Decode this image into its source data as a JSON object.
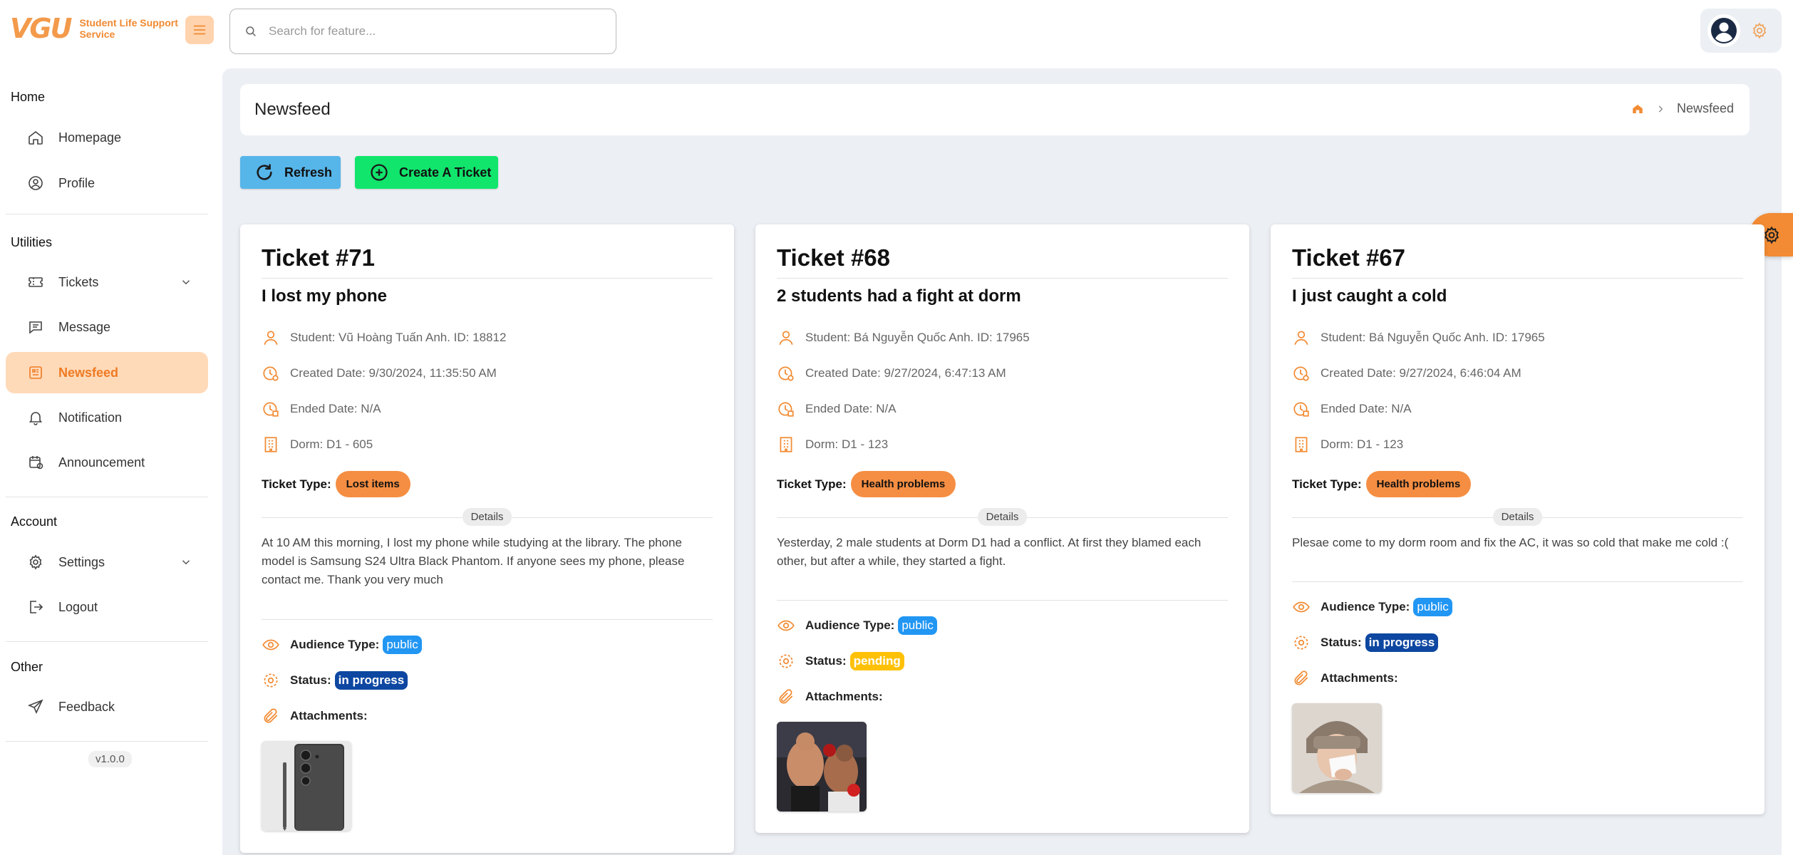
{
  "app": {
    "logo_mark": "VGU",
    "logo_text": "Student Life Support Service"
  },
  "search": {
    "placeholder": "Search for feature..."
  },
  "sidebar": {
    "sections": [
      "Home",
      "Utilities",
      "Account",
      "Other"
    ],
    "items": [
      {
        "label": "Homepage",
        "icon": "home-icon"
      },
      {
        "label": "Profile",
        "icon": "user-circle-icon"
      },
      {
        "label": "Tickets",
        "icon": "ticket-icon"
      },
      {
        "label": "Message",
        "icon": "message-icon"
      },
      {
        "label": "Newsfeed",
        "icon": "newsfeed-icon"
      },
      {
        "label": "Notification",
        "icon": "bell-icon"
      },
      {
        "label": "Announcement",
        "icon": "calendar-icon"
      },
      {
        "label": "Settings",
        "icon": "gear-icon"
      },
      {
        "label": "Logout",
        "icon": "logout-icon"
      },
      {
        "label": "Feedback",
        "icon": "send-icon"
      }
    ],
    "active": "Newsfeed",
    "version": "v1.0.0"
  },
  "page": {
    "title": "Newsfeed",
    "breadcrumb": "Newsfeed"
  },
  "actions": {
    "refresh": "Refresh",
    "create": "Create A Ticket"
  },
  "labels": {
    "ticket_type": "Ticket Type:",
    "details": "Details",
    "audience": "Audience Type:",
    "status": "Status:",
    "attachments": "Attachments:"
  },
  "tickets": [
    {
      "number": "Ticket #71",
      "title": "I lost my phone",
      "student": "Student: Vũ Hoàng Tuấn Anh. ID: 18812",
      "created": "Created Date: 9/30/2024, 11:35:50 AM",
      "ended": "Ended Date: N/A",
      "dorm": "Dorm: D1 - 605",
      "type": "Lost items",
      "description": "At 10 AM this morning, I lost my phone while studying at the library. The phone model is Samsung S24 Ultra Black Phantom. If anyone sees my phone, please contact me. Thank you very much",
      "audience": "public",
      "status": "in progress",
      "attachment": "phone-photo"
    },
    {
      "number": "Ticket #68",
      "title": "2 students had a fight at dorm",
      "student": "Student: Bá Nguyễn Quốc Anh. ID: 17965",
      "created": "Created Date: 9/27/2024, 6:47:13 AM",
      "ended": "Ended Date: N/A",
      "dorm": "Dorm: D1 - 123",
      "type": "Health problems",
      "description": "Yesterday, 2 male students at Dorm D1 had a conflict. At first they blamed each other, but after a while, they started a fight.",
      "audience": "public",
      "status": "pending",
      "attachment": "fight-photo"
    },
    {
      "number": "Ticket #67",
      "title": "I just caught a cold",
      "student": "Student: Bá Nguyễn Quốc Anh. ID: 17965",
      "created": "Created Date: 9/27/2024, 6:46:04 AM",
      "ended": "Ended Date: N/A",
      "dorm": "Dorm: D1 - 123",
      "type": "Health problems",
      "description": "Plesae come to my dorm room and fix the AC, it was so cold that make me cold :(",
      "audience": "public",
      "status": "in progress",
      "attachment": "cold-photo"
    }
  ],
  "colors": {
    "accent": "#f28b33",
    "active_bg": "#ffdab9",
    "refresh": "#56b5e9",
    "create": "#11e56c",
    "public": "#2196f3",
    "in_progress": "#0d47a1",
    "pending": "#ffc107"
  }
}
